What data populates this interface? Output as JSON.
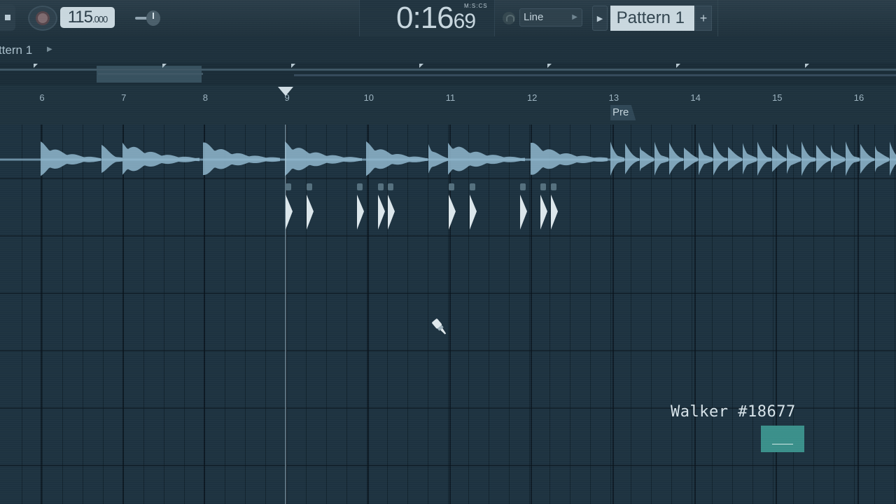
{
  "toolbar": {
    "tempo_main": "115",
    "tempo_fraction": ".000",
    "song_time": "0:16",
    "song_time_cs": "69",
    "time_format_label": "M:S:CS",
    "snap_mode": "Line",
    "pattern_name": "Pattern 1",
    "pattern_add_label": "+"
  },
  "playlist": {
    "title": "ttern 1",
    "bar_numbers": [
      "6",
      "7",
      "8",
      "9",
      "10",
      "11",
      "12",
      "13",
      "14",
      "15",
      "16"
    ],
    "markers": [
      {
        "label": "Pre"
      }
    ]
  },
  "watermark": {
    "text": "Walker #18677"
  },
  "colors": {
    "background": "#1c2f3b",
    "waveform": "#8fb7ce",
    "playhead": "#d0dde4",
    "display": "#c9d7de"
  },
  "icons": [
    "stop-icon",
    "record-icon",
    "pitch-knob-icon",
    "snap-magnet-icon",
    "paint-brush-cursor-icon"
  ]
}
